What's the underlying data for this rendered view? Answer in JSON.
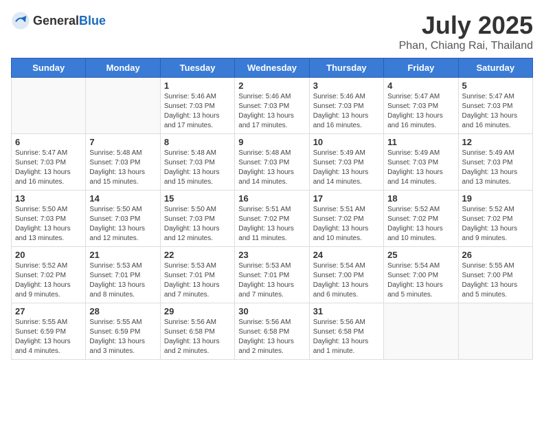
{
  "header": {
    "logo_general": "General",
    "logo_blue": "Blue",
    "month": "July 2025",
    "location": "Phan, Chiang Rai, Thailand"
  },
  "weekdays": [
    "Sunday",
    "Monday",
    "Tuesday",
    "Wednesday",
    "Thursday",
    "Friday",
    "Saturday"
  ],
  "weeks": [
    [
      {
        "day": "",
        "info": ""
      },
      {
        "day": "",
        "info": ""
      },
      {
        "day": "1",
        "info": "Sunrise: 5:46 AM\nSunset: 7:03 PM\nDaylight: 13 hours and 17 minutes."
      },
      {
        "day": "2",
        "info": "Sunrise: 5:46 AM\nSunset: 7:03 PM\nDaylight: 13 hours and 17 minutes."
      },
      {
        "day": "3",
        "info": "Sunrise: 5:46 AM\nSunset: 7:03 PM\nDaylight: 13 hours and 16 minutes."
      },
      {
        "day": "4",
        "info": "Sunrise: 5:47 AM\nSunset: 7:03 PM\nDaylight: 13 hours and 16 minutes."
      },
      {
        "day": "5",
        "info": "Sunrise: 5:47 AM\nSunset: 7:03 PM\nDaylight: 13 hours and 16 minutes."
      }
    ],
    [
      {
        "day": "6",
        "info": "Sunrise: 5:47 AM\nSunset: 7:03 PM\nDaylight: 13 hours and 16 minutes."
      },
      {
        "day": "7",
        "info": "Sunrise: 5:48 AM\nSunset: 7:03 PM\nDaylight: 13 hours and 15 minutes."
      },
      {
        "day": "8",
        "info": "Sunrise: 5:48 AM\nSunset: 7:03 PM\nDaylight: 13 hours and 15 minutes."
      },
      {
        "day": "9",
        "info": "Sunrise: 5:48 AM\nSunset: 7:03 PM\nDaylight: 13 hours and 14 minutes."
      },
      {
        "day": "10",
        "info": "Sunrise: 5:49 AM\nSunset: 7:03 PM\nDaylight: 13 hours and 14 minutes."
      },
      {
        "day": "11",
        "info": "Sunrise: 5:49 AM\nSunset: 7:03 PM\nDaylight: 13 hours and 14 minutes."
      },
      {
        "day": "12",
        "info": "Sunrise: 5:49 AM\nSunset: 7:03 PM\nDaylight: 13 hours and 13 minutes."
      }
    ],
    [
      {
        "day": "13",
        "info": "Sunrise: 5:50 AM\nSunset: 7:03 PM\nDaylight: 13 hours and 13 minutes."
      },
      {
        "day": "14",
        "info": "Sunrise: 5:50 AM\nSunset: 7:03 PM\nDaylight: 13 hours and 12 minutes."
      },
      {
        "day": "15",
        "info": "Sunrise: 5:50 AM\nSunset: 7:03 PM\nDaylight: 13 hours and 12 minutes."
      },
      {
        "day": "16",
        "info": "Sunrise: 5:51 AM\nSunset: 7:02 PM\nDaylight: 13 hours and 11 minutes."
      },
      {
        "day": "17",
        "info": "Sunrise: 5:51 AM\nSunset: 7:02 PM\nDaylight: 13 hours and 10 minutes."
      },
      {
        "day": "18",
        "info": "Sunrise: 5:52 AM\nSunset: 7:02 PM\nDaylight: 13 hours and 10 minutes."
      },
      {
        "day": "19",
        "info": "Sunrise: 5:52 AM\nSunset: 7:02 PM\nDaylight: 13 hours and 9 minutes."
      }
    ],
    [
      {
        "day": "20",
        "info": "Sunrise: 5:52 AM\nSunset: 7:02 PM\nDaylight: 13 hours and 9 minutes."
      },
      {
        "day": "21",
        "info": "Sunrise: 5:53 AM\nSunset: 7:01 PM\nDaylight: 13 hours and 8 minutes."
      },
      {
        "day": "22",
        "info": "Sunrise: 5:53 AM\nSunset: 7:01 PM\nDaylight: 13 hours and 7 minutes."
      },
      {
        "day": "23",
        "info": "Sunrise: 5:53 AM\nSunset: 7:01 PM\nDaylight: 13 hours and 7 minutes."
      },
      {
        "day": "24",
        "info": "Sunrise: 5:54 AM\nSunset: 7:00 PM\nDaylight: 13 hours and 6 minutes."
      },
      {
        "day": "25",
        "info": "Sunrise: 5:54 AM\nSunset: 7:00 PM\nDaylight: 13 hours and 5 minutes."
      },
      {
        "day": "26",
        "info": "Sunrise: 5:55 AM\nSunset: 7:00 PM\nDaylight: 13 hours and 5 minutes."
      }
    ],
    [
      {
        "day": "27",
        "info": "Sunrise: 5:55 AM\nSunset: 6:59 PM\nDaylight: 13 hours and 4 minutes."
      },
      {
        "day": "28",
        "info": "Sunrise: 5:55 AM\nSunset: 6:59 PM\nDaylight: 13 hours and 3 minutes."
      },
      {
        "day": "29",
        "info": "Sunrise: 5:56 AM\nSunset: 6:58 PM\nDaylight: 13 hours and 2 minutes."
      },
      {
        "day": "30",
        "info": "Sunrise: 5:56 AM\nSunset: 6:58 PM\nDaylight: 13 hours and 2 minutes."
      },
      {
        "day": "31",
        "info": "Sunrise: 5:56 AM\nSunset: 6:58 PM\nDaylight: 13 hours and 1 minute."
      },
      {
        "day": "",
        "info": ""
      },
      {
        "day": "",
        "info": ""
      }
    ]
  ]
}
